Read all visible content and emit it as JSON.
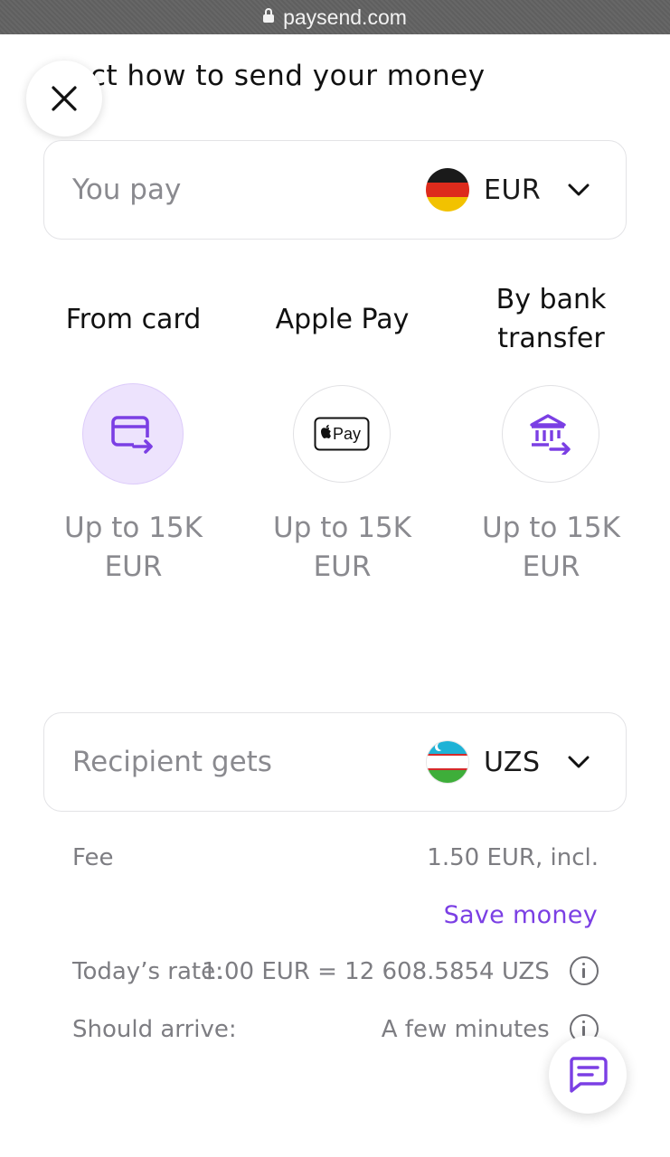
{
  "browser": {
    "url": "paysend.com"
  },
  "page": {
    "title": "ct how to send your money"
  },
  "pay_field": {
    "label": "You pay",
    "currency": "EUR",
    "flag": "germany-flag"
  },
  "methods": [
    {
      "label_line1": "From card",
      "label_line2": "",
      "limit_line1": "Up to 15K",
      "limit_line2": "EUR",
      "icon": "card-transfer-icon",
      "selected": true
    },
    {
      "label_line1": "Apple Pay",
      "label_line2": "",
      "limit_line1": "Up to 15K",
      "limit_line2": "EUR",
      "icon": "apple-pay-icon",
      "selected": false,
      "icon_text": "Pay"
    },
    {
      "label_line1": "By bank",
      "label_line2": "transfer",
      "limit_line1": "Up to 15K",
      "limit_line2": "EUR",
      "icon": "bank-transfer-icon",
      "selected": false
    }
  ],
  "recipient_field": {
    "label": "Recipient gets",
    "currency": "UZS",
    "flag": "uzbekistan-flag"
  },
  "fee": {
    "label": "Fee",
    "value": "1.50 EUR, incl."
  },
  "save_money": {
    "label": "Save money"
  },
  "rate": {
    "label": "Today’s rate:",
    "value": "1.00 EUR = 12 608.5854 UZS"
  },
  "arrival": {
    "label": "Should arrive:",
    "value": "A few minutes"
  },
  "colors": {
    "accent": "#7b3fe4",
    "selected_bg": "#ede3fd",
    "muted_text": "#8a8a8f",
    "border": "#e3e3e6"
  }
}
